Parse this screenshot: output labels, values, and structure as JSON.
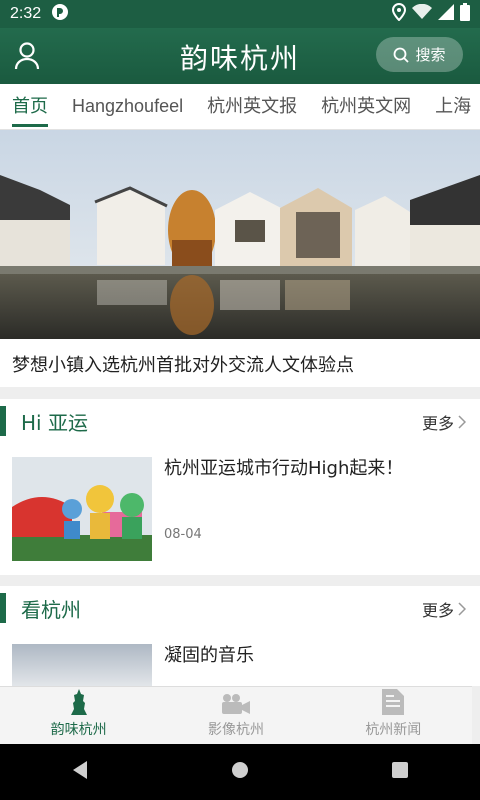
{
  "status": {
    "time": "2:32"
  },
  "header": {
    "title": "韵味杭州",
    "search_label": "搜索"
  },
  "tabs": [
    {
      "label": "首页",
      "active": true
    },
    {
      "label": "Hangzhoufeel",
      "active": false
    },
    {
      "label": "杭州英文报",
      "active": false
    },
    {
      "label": "杭州英文网",
      "active": false
    },
    {
      "label": "上海",
      "active": false
    }
  ],
  "hero": {
    "caption": "梦想小镇入选杭州首批对外交流人文体验点"
  },
  "sections": [
    {
      "title": "Hi 亚运",
      "more": "更多",
      "items": [
        {
          "title": "杭州亚运城市行动High起来！",
          "date": "08-04"
        }
      ]
    },
    {
      "title": "看杭州",
      "more": "更多",
      "items": [
        {
          "title": "凝固的音乐",
          "date": ""
        }
      ]
    }
  ],
  "bottom_nav": [
    {
      "label": "韵味杭州",
      "icon": "tower-icon",
      "active": true
    },
    {
      "label": "影像杭州",
      "icon": "video-camera-icon",
      "active": false
    },
    {
      "label": "杭州新闻",
      "icon": "document-icon",
      "active": false
    }
  ],
  "colors": {
    "brand": "#1d6a49",
    "header": "#1d5e43"
  }
}
